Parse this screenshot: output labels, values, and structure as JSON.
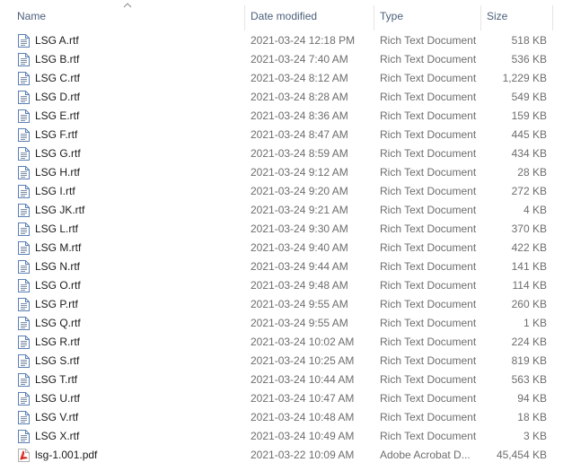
{
  "columns": {
    "name": "Name",
    "date": "Date modified",
    "type": "Type",
    "size": "Size"
  },
  "sort": {
    "column": "name",
    "direction": "ascending"
  },
  "colors": {
    "header_text": "#4c607a",
    "secondary_text": "#6d6d6d",
    "pdf_red": "#d42a1e",
    "doc_icon_blue": "#5a7fb5"
  },
  "files": [
    {
      "name": "LSG A.rtf",
      "date": "2021-03-24 12:18 PM",
      "type": "Rich Text Document",
      "size": "518 KB",
      "icon": "rtf-document-icon"
    },
    {
      "name": "LSG B.rtf",
      "date": "2021-03-24 7:40 AM",
      "type": "Rich Text Document",
      "size": "536 KB",
      "icon": "rtf-document-icon"
    },
    {
      "name": "LSG C.rtf",
      "date": "2021-03-24 8:12 AM",
      "type": "Rich Text Document",
      "size": "1,229 KB",
      "icon": "rtf-document-icon"
    },
    {
      "name": "LSG D.rtf",
      "date": "2021-03-24 8:28 AM",
      "type": "Rich Text Document",
      "size": "549 KB",
      "icon": "rtf-document-icon"
    },
    {
      "name": "LSG E.rtf",
      "date": "2021-03-24 8:36 AM",
      "type": "Rich Text Document",
      "size": "159 KB",
      "icon": "rtf-document-icon"
    },
    {
      "name": "LSG F.rtf",
      "date": "2021-03-24 8:47 AM",
      "type": "Rich Text Document",
      "size": "445 KB",
      "icon": "rtf-document-icon"
    },
    {
      "name": "LSG G.rtf",
      "date": "2021-03-24 8:59 AM",
      "type": "Rich Text Document",
      "size": "434 KB",
      "icon": "rtf-document-icon"
    },
    {
      "name": "LSG H.rtf",
      "date": "2021-03-24 9:12 AM",
      "type": "Rich Text Document",
      "size": "28 KB",
      "icon": "rtf-document-icon"
    },
    {
      "name": "LSG I.rtf",
      "date": "2021-03-24 9:20 AM",
      "type": "Rich Text Document",
      "size": "272 KB",
      "icon": "rtf-document-icon"
    },
    {
      "name": "LSG JK.rtf",
      "date": "2021-03-24 9:21 AM",
      "type": "Rich Text Document",
      "size": "4 KB",
      "icon": "rtf-document-icon"
    },
    {
      "name": "LSG L.rtf",
      "date": "2021-03-24 9:30 AM",
      "type": "Rich Text Document",
      "size": "370 KB",
      "icon": "rtf-document-icon"
    },
    {
      "name": "LSG M.rtf",
      "date": "2021-03-24 9:40 AM",
      "type": "Rich Text Document",
      "size": "422 KB",
      "icon": "rtf-document-icon"
    },
    {
      "name": "LSG N.rtf",
      "date": "2021-03-24 9:44 AM",
      "type": "Rich Text Document",
      "size": "141 KB",
      "icon": "rtf-document-icon"
    },
    {
      "name": "LSG O.rtf",
      "date": "2021-03-24 9:48 AM",
      "type": "Rich Text Document",
      "size": "114 KB",
      "icon": "rtf-document-icon"
    },
    {
      "name": "LSG P.rtf",
      "date": "2021-03-24 9:55 AM",
      "type": "Rich Text Document",
      "size": "260 KB",
      "icon": "rtf-document-icon"
    },
    {
      "name": "LSG Q.rtf",
      "date": "2021-03-24 9:55 AM",
      "type": "Rich Text Document",
      "size": "1 KB",
      "icon": "rtf-document-icon"
    },
    {
      "name": "LSG R.rtf",
      "date": "2021-03-24 10:02 AM",
      "type": "Rich Text Document",
      "size": "224 KB",
      "icon": "rtf-document-icon"
    },
    {
      "name": "LSG S.rtf",
      "date": "2021-03-24 10:25 AM",
      "type": "Rich Text Document",
      "size": "819 KB",
      "icon": "rtf-document-icon"
    },
    {
      "name": "LSG T.rtf",
      "date": "2021-03-24 10:44 AM",
      "type": "Rich Text Document",
      "size": "563 KB",
      "icon": "rtf-document-icon"
    },
    {
      "name": "LSG U.rtf",
      "date": "2021-03-24 10:47 AM",
      "type": "Rich Text Document",
      "size": "94 KB",
      "icon": "rtf-document-icon"
    },
    {
      "name": "LSG V.rtf",
      "date": "2021-03-24 10:48 AM",
      "type": "Rich Text Document",
      "size": "18 KB",
      "icon": "rtf-document-icon"
    },
    {
      "name": "LSG X.rtf",
      "date": "2021-03-24 10:49 AM",
      "type": "Rich Text Document",
      "size": "3 KB",
      "icon": "rtf-document-icon"
    },
    {
      "name": "lsg-1.001.pdf",
      "date": "2021-03-22 10:09 AM",
      "type": "Adobe Acrobat D...",
      "size": "45,454 KB",
      "icon": "pdf-document-icon"
    }
  ]
}
